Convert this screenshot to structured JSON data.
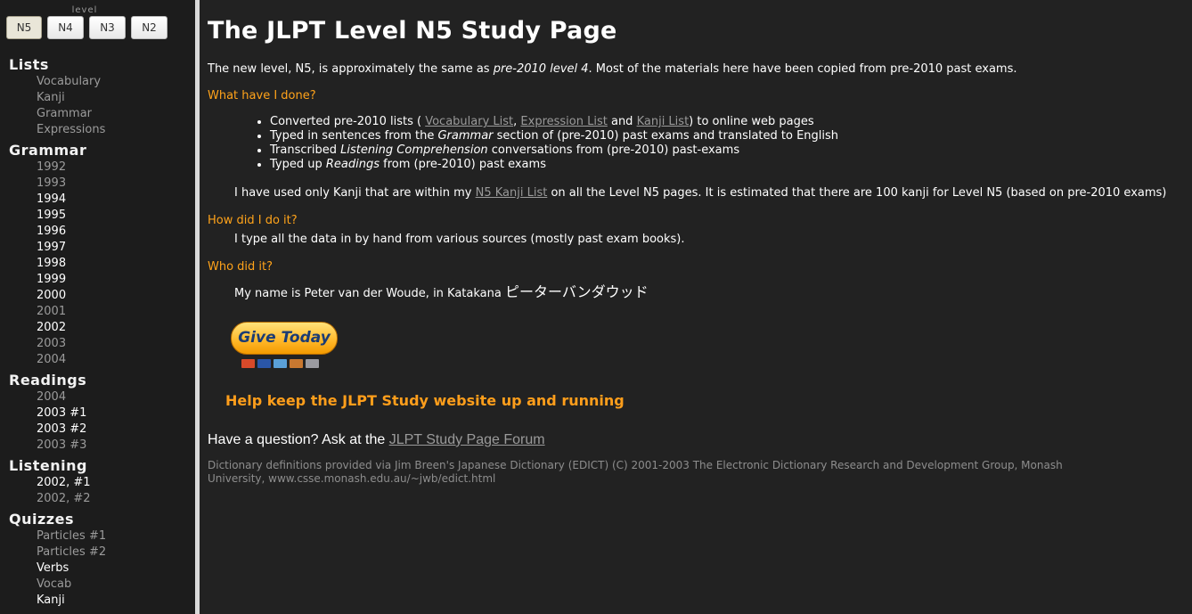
{
  "sidebar": {
    "level_caption": "level",
    "levels": [
      {
        "label": "N5",
        "active": true
      },
      {
        "label": "N4",
        "active": false
      },
      {
        "label": "N3",
        "active": false
      },
      {
        "label": "N2",
        "active": false
      }
    ],
    "sections": [
      {
        "heading": "Lists",
        "items": [
          {
            "label": "Vocabulary",
            "bright": false
          },
          {
            "label": "Kanji",
            "bright": false
          },
          {
            "label": "Grammar",
            "bright": false
          },
          {
            "label": "Expressions",
            "bright": false
          }
        ]
      },
      {
        "heading": "Grammar",
        "items": [
          {
            "label": "1992",
            "bright": false
          },
          {
            "label": "1993",
            "bright": false
          },
          {
            "label": "1994",
            "bright": true
          },
          {
            "label": "1995",
            "bright": true
          },
          {
            "label": "1996",
            "bright": true
          },
          {
            "label": "1997",
            "bright": true
          },
          {
            "label": "1998",
            "bright": true
          },
          {
            "label": "1999",
            "bright": true
          },
          {
            "label": "2000",
            "bright": true
          },
          {
            "label": "2001",
            "bright": false
          },
          {
            "label": "2002",
            "bright": true
          },
          {
            "label": "2003",
            "bright": false
          },
          {
            "label": "2004",
            "bright": false
          }
        ]
      },
      {
        "heading": "Readings",
        "items": [
          {
            "label": "2004",
            "bright": false
          },
          {
            "label": "2003 #1",
            "bright": true
          },
          {
            "label": "2003 #2",
            "bright": true
          },
          {
            "label": "2003 #3",
            "bright": false
          }
        ]
      },
      {
        "heading": "Listening",
        "items": [
          {
            "label": "2002, #1",
            "bright": true
          },
          {
            "label": "2002, #2",
            "bright": false
          }
        ]
      },
      {
        "heading": "Quizzes",
        "items": [
          {
            "label": "Particles #1",
            "bright": false
          },
          {
            "label": "Particles #2",
            "bright": false
          },
          {
            "label": "Verbs",
            "bright": true
          },
          {
            "label": "Vocab",
            "bright": false
          },
          {
            "label": "Kanji",
            "bright": true
          }
        ]
      }
    ]
  },
  "main": {
    "title": "The JLPT Level N5 Study Page",
    "intro": {
      "pre": "The new level, N5, is approximately the same as ",
      "em": "pre-2010 level 4",
      "post": ". Most of the materials here have been copied from pre-2010 past exams."
    },
    "what_heading": "What have I done?",
    "done_list": {
      "item1": {
        "pre": "Converted pre-2010 lists ( ",
        "link1": "Vocabulary List",
        "sep1": ", ",
        "link2": "Expression List",
        "sep2": " and ",
        "link3": "Kanji List",
        "post": ") to online web pages"
      },
      "item2": {
        "pre": "Typed in sentences from the ",
        "em": "Grammar",
        "post": " section of (pre-2010) past exams and translated to English"
      },
      "item3": {
        "pre": "Transcribed ",
        "em": "Listening Comprehension",
        "post": " conversations from (pre-2010) past-exams"
      },
      "item4": {
        "pre": "Typed up ",
        "em": "Readings",
        "post": " from (pre-2010) past exams"
      }
    },
    "kanji_note": {
      "pre": "I have used only Kanji that are within my ",
      "link": "N5 Kanji List",
      "post": " on all the Level N5 pages. It is estimated that there are 100 kanji for Level N5 (based on pre-2010 exams)"
    },
    "how_heading": "How did I do it?",
    "how_text": "I type all the data in by hand from various sources (mostly past exam books).",
    "who_heading": "Who did it?",
    "who_text": {
      "pre": "My name is Peter van der Woude, in Katakana ",
      "katakana": "ピーターバンダウッド"
    },
    "give_label": "Give Today",
    "card_colors": [
      "#d84a2a",
      "#2a56a8",
      "#5aa0d8",
      "#c87830",
      "#9a9aa0"
    ],
    "help_text": "Help keep the JLPT Study website up and running",
    "question": {
      "pre": "Have a question? Ask at the ",
      "link": "JLPT Study Page Forum"
    },
    "credits": "Dictionary definitions provided via Jim Breen's Japanese Dictionary (EDICT) (C) 2001-2003 The Electronic Dictionary Research and Development Group, Monash University, www.csse.monash.edu.au/~jwb/edict.html"
  }
}
